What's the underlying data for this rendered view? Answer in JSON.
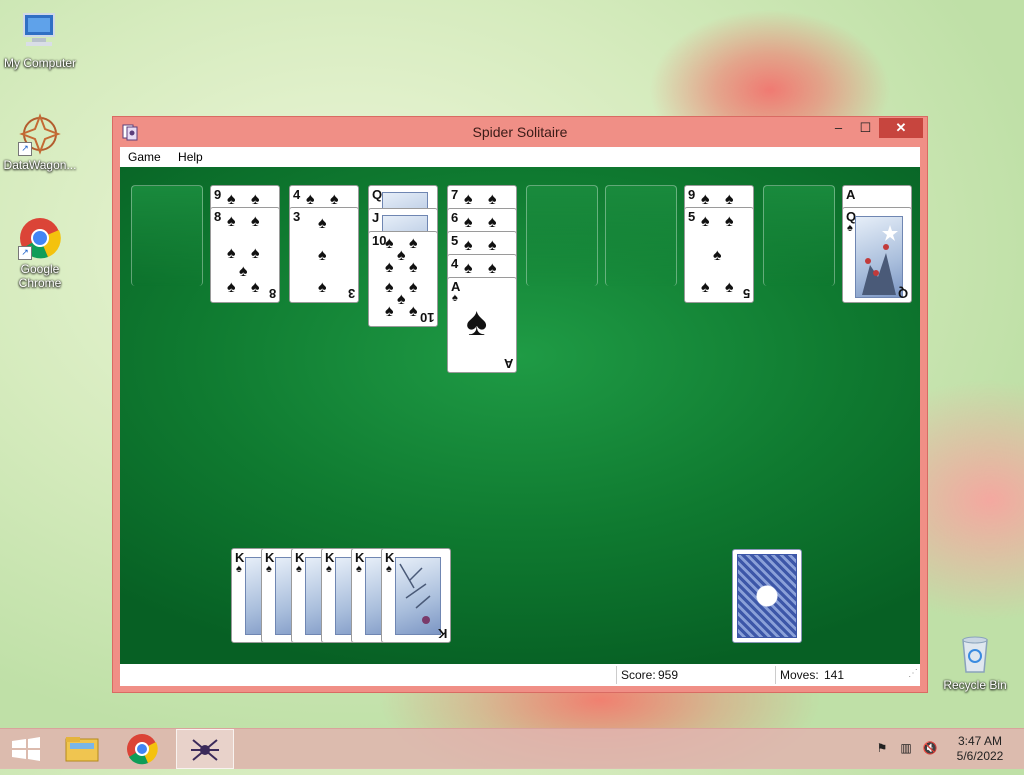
{
  "desktop": {
    "icons": [
      {
        "label": "My Computer"
      },
      {
        "label": "DataWagon..."
      },
      {
        "label": "Google Chrome"
      },
      {
        "label": "Recycle Bin"
      }
    ]
  },
  "window": {
    "title": "Spider Solitaire",
    "controls": {
      "minimize": "–",
      "maximize": "☐",
      "close": "✕"
    },
    "menu": [
      "Game",
      "Help"
    ]
  },
  "game": {
    "tableau": [
      {
        "cards": []
      },
      {
        "cards": [
          "9",
          "8"
        ]
      },
      {
        "cards": [
          "4",
          "3"
        ]
      },
      {
        "cards": [
          "Q",
          "J",
          "10"
        ]
      },
      {
        "cards": [
          "7",
          "6",
          "5",
          "4",
          "A"
        ]
      },
      {
        "cards": []
      },
      {
        "cards": []
      },
      {
        "cards": [
          "9",
          "5"
        ]
      },
      {
        "cards": []
      },
      {
        "cards": [
          "A",
          "Q"
        ]
      }
    ],
    "completed_suits": [
      "K",
      "K",
      "K",
      "K",
      "K",
      "K"
    ],
    "stock": {
      "remaining_deals": 1
    }
  },
  "status": {
    "score_label": "Score:",
    "score_value": "959",
    "moves_label": "Moves:",
    "moves_value": "141"
  },
  "taskbar": {
    "apps": [
      "start-button",
      "file-explorer",
      "google-chrome",
      "spider-solitaire"
    ],
    "time": "3:47 AM",
    "date": "5/6/2022"
  }
}
